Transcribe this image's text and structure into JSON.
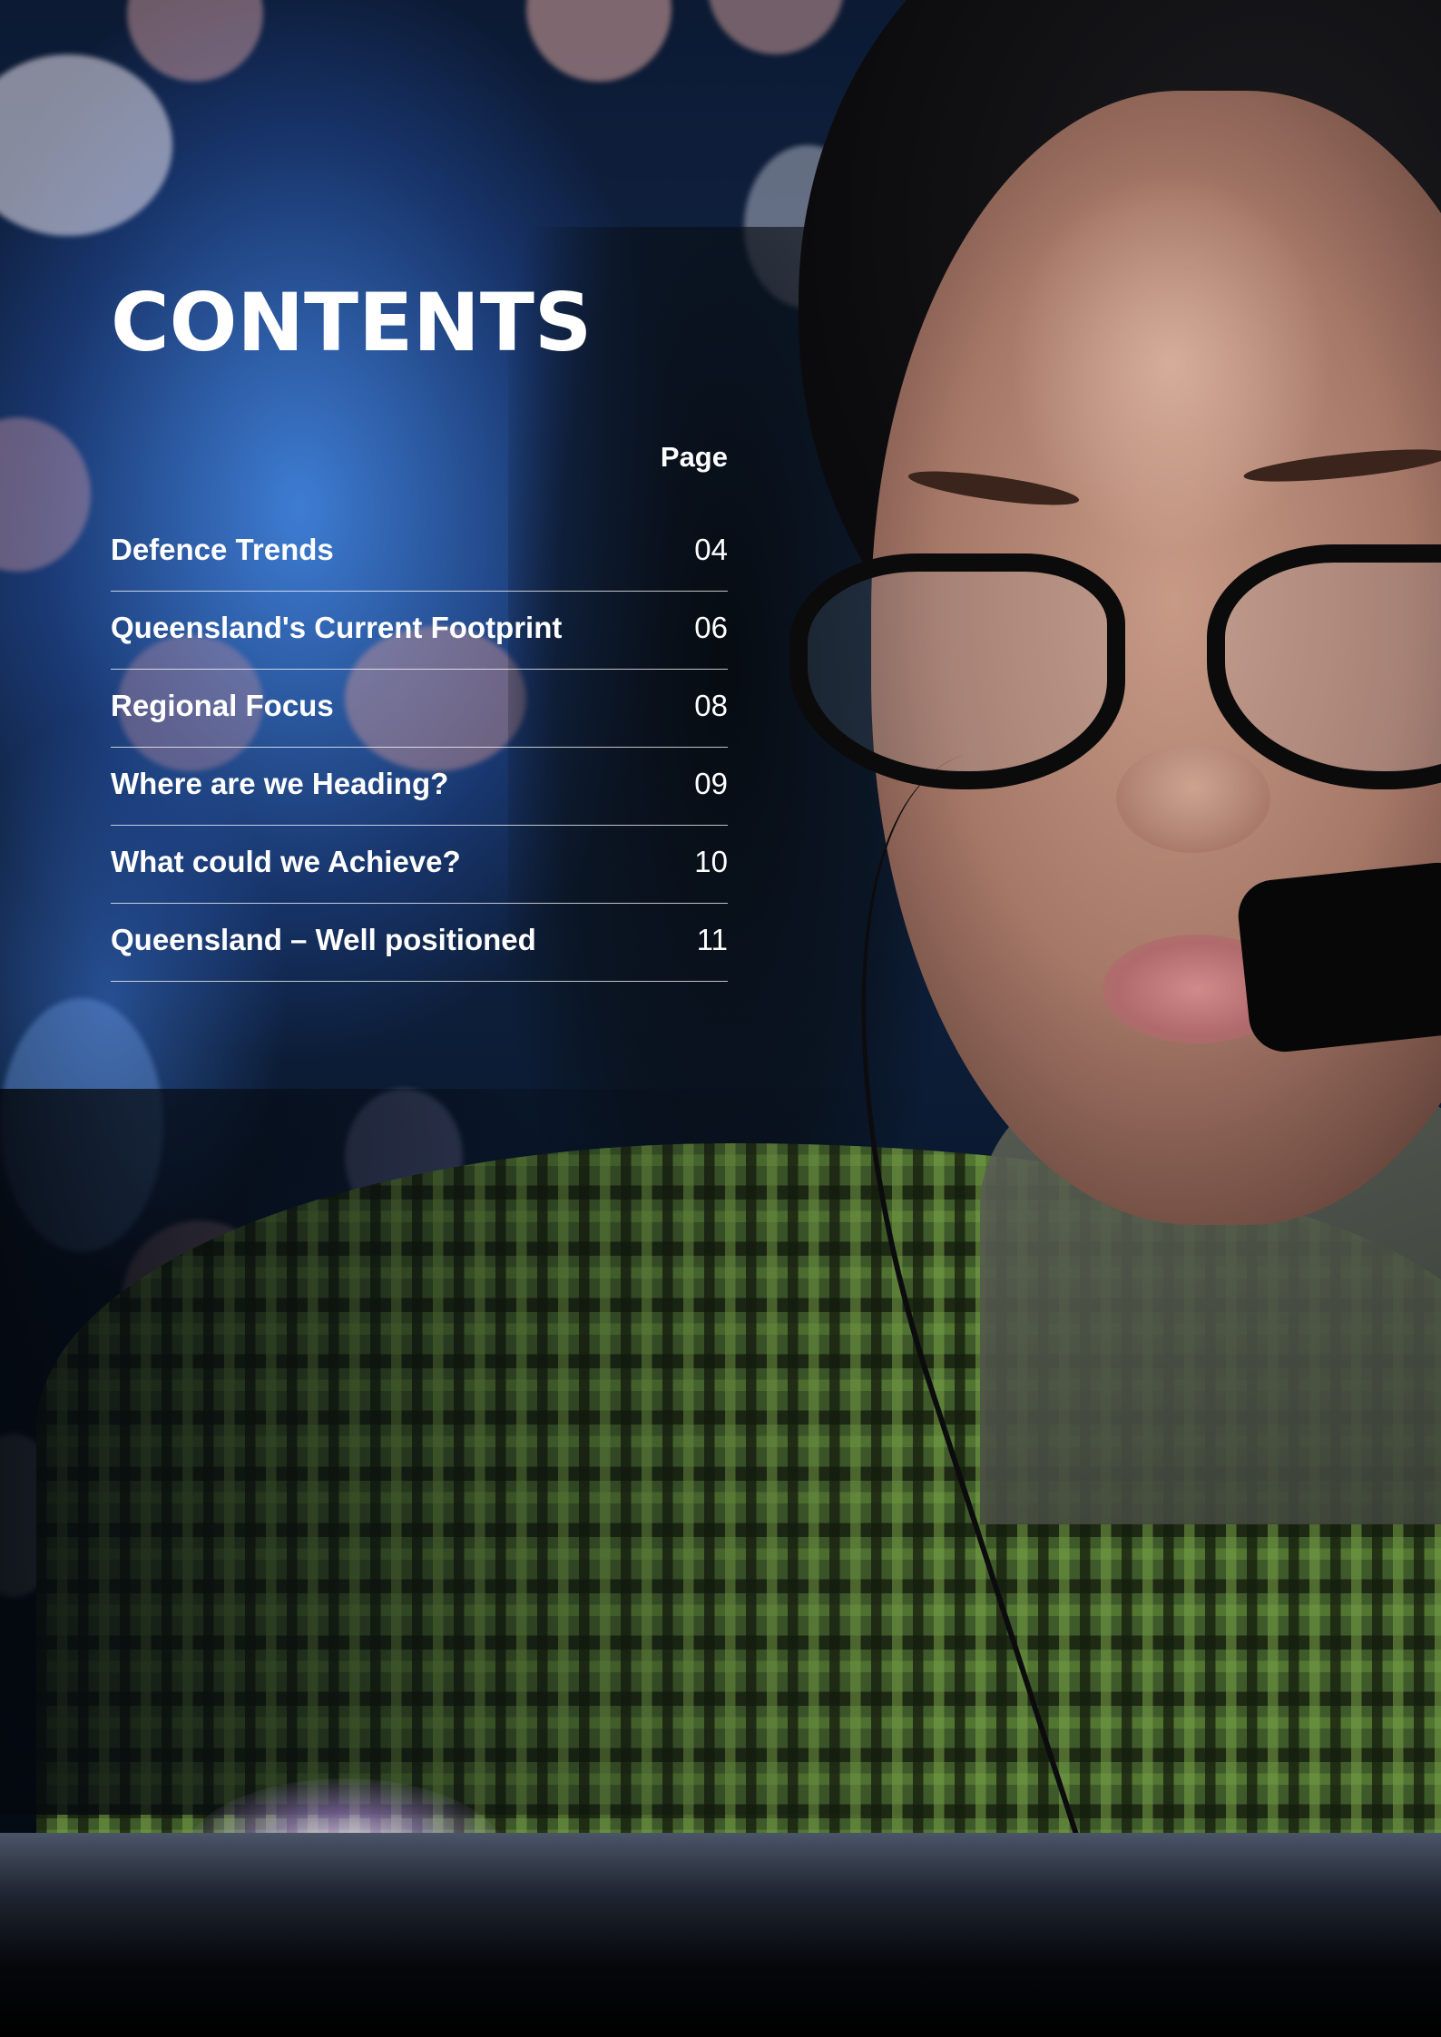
{
  "contents": {
    "title": "CONTENTS",
    "page_heading": "Page",
    "entries": [
      {
        "title": "Defence Trends",
        "page": "04"
      },
      {
        "title": "Queensland's Current Footprint",
        "page": "06"
      },
      {
        "title": "Regional Focus",
        "page": "08"
      },
      {
        "title": "Where are we Heading?",
        "page": "09"
      },
      {
        "title": "What could we Achieve?",
        "page": "10"
      },
      {
        "title": "Queensland – Well positioned",
        "page": "11"
      }
    ]
  },
  "colors": {
    "text": "#ffffff",
    "background_blue": "#13284d",
    "uniform_green": "#3f5a2a"
  }
}
